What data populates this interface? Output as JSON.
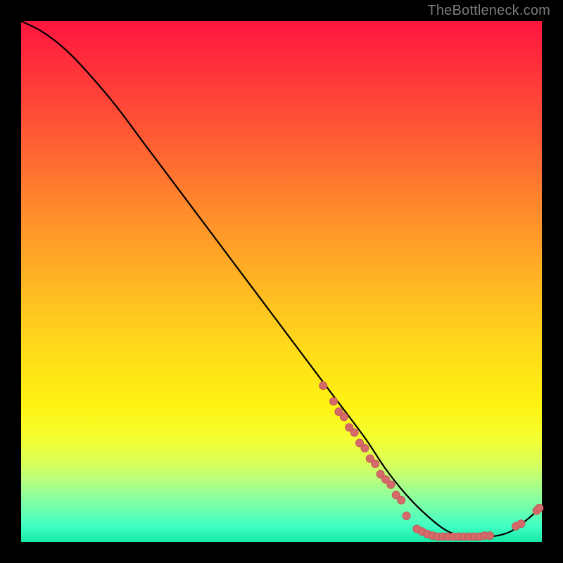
{
  "watermark": "TheBottleneck.com",
  "chart_data": {
    "type": "line",
    "title": "",
    "xlabel": "",
    "ylabel": "",
    "xlim": [
      0,
      100
    ],
    "ylim": [
      0,
      100
    ],
    "series": [
      {
        "name": "curve",
        "x": [
          0,
          4,
          8,
          12,
          18,
          24,
          30,
          36,
          42,
          48,
          54,
          60,
          66,
          70,
          74,
          78,
          82,
          86,
          90,
          94,
          98,
          100
        ],
        "values": [
          100,
          98,
          95,
          91,
          84,
          76,
          68,
          60,
          52,
          44,
          36,
          28,
          20,
          14,
          9,
          5,
          2,
          1,
          1,
          2,
          5,
          7
        ]
      }
    ],
    "markers": [
      {
        "x": 58,
        "y": 30
      },
      {
        "x": 60,
        "y": 27
      },
      {
        "x": 61,
        "y": 25
      },
      {
        "x": 62,
        "y": 24
      },
      {
        "x": 63,
        "y": 22
      },
      {
        "x": 64,
        "y": 21
      },
      {
        "x": 65,
        "y": 19
      },
      {
        "x": 66,
        "y": 18
      },
      {
        "x": 67,
        "y": 16
      },
      {
        "x": 68,
        "y": 15
      },
      {
        "x": 69,
        "y": 13
      },
      {
        "x": 70,
        "y": 12
      },
      {
        "x": 71,
        "y": 11
      },
      {
        "x": 72,
        "y": 9
      },
      {
        "x": 73,
        "y": 8
      },
      {
        "x": 74,
        "y": 5
      },
      {
        "x": 76,
        "y": 2.5
      },
      {
        "x": 77,
        "y": 2
      },
      {
        "x": 78,
        "y": 1.5
      },
      {
        "x": 79,
        "y": 1.2
      },
      {
        "x": 80,
        "y": 1
      },
      {
        "x": 81,
        "y": 1
      },
      {
        "x": 82,
        "y": 1
      },
      {
        "x": 83,
        "y": 1
      },
      {
        "x": 84,
        "y": 1
      },
      {
        "x": 85,
        "y": 1
      },
      {
        "x": 86,
        "y": 1
      },
      {
        "x": 87,
        "y": 1
      },
      {
        "x": 88,
        "y": 1
      },
      {
        "x": 89,
        "y": 1.2
      },
      {
        "x": 90,
        "y": 1.2
      },
      {
        "x": 95,
        "y": 3
      },
      {
        "x": 96,
        "y": 3.5
      },
      {
        "x": 99,
        "y": 6
      },
      {
        "x": 99.5,
        "y": 6.5
      }
    ],
    "colors": {
      "curve": "#000000",
      "marker_fill": "#d46a6a",
      "marker_stroke": "#c45858"
    }
  }
}
